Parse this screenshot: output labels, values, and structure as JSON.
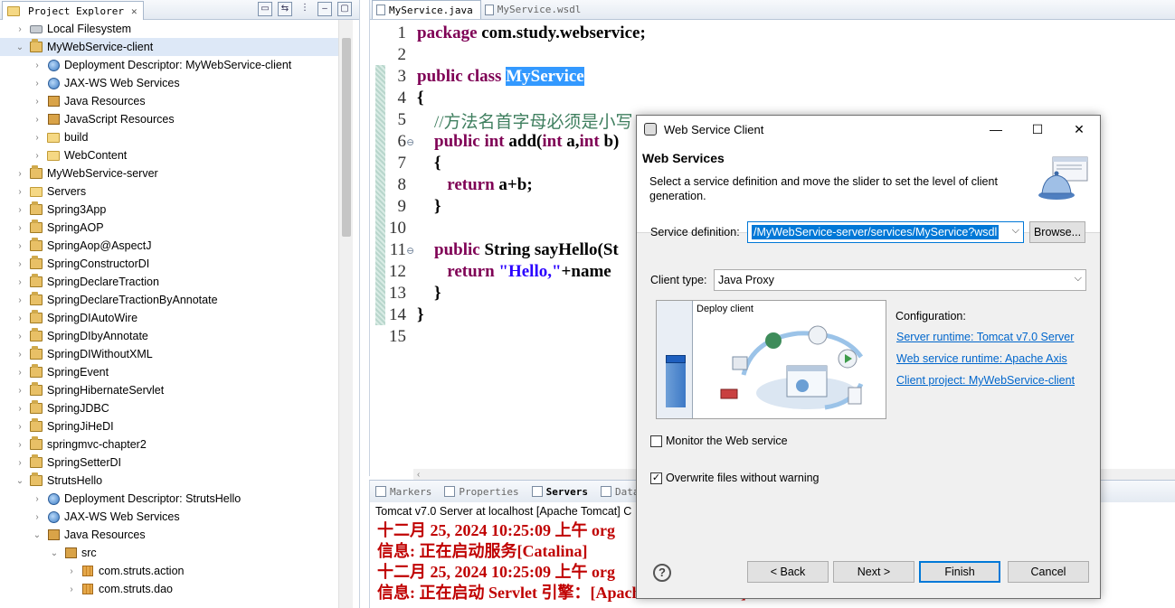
{
  "explorer": {
    "tab_label": "Project Explorer",
    "tree": [
      {
        "label": "Local Filesystem",
        "indent": 0,
        "chevron": "›",
        "icon": "drive"
      },
      {
        "label": "MyWebService-client",
        "indent": 0,
        "chevron": "⌄",
        "icon": "proj",
        "selected": true
      },
      {
        "label": "Deployment Descriptor: MyWebService-client",
        "indent": 1,
        "chevron": "›",
        "icon": "globe"
      },
      {
        "label": "JAX-WS Web Services",
        "indent": 1,
        "chevron": "›",
        "icon": "globe"
      },
      {
        "label": "Java Resources",
        "indent": 1,
        "chevron": "›",
        "icon": "jarpkg"
      },
      {
        "label": "JavaScript Resources",
        "indent": 1,
        "chevron": "›",
        "icon": "jarpkg"
      },
      {
        "label": "build",
        "indent": 1,
        "chevron": "›",
        "icon": "folder"
      },
      {
        "label": "WebContent",
        "indent": 1,
        "chevron": "›",
        "icon": "folder"
      },
      {
        "label": "MyWebService-server",
        "indent": 0,
        "chevron": "›",
        "icon": "proj"
      },
      {
        "label": "Servers",
        "indent": 0,
        "chevron": "›",
        "icon": "folder"
      },
      {
        "label": "Spring3App",
        "indent": 0,
        "chevron": "›",
        "icon": "proj"
      },
      {
        "label": "SpringAOP",
        "indent": 0,
        "chevron": "›",
        "icon": "proj"
      },
      {
        "label": "SpringAop@AspectJ",
        "indent": 0,
        "chevron": "›",
        "icon": "proj"
      },
      {
        "label": "SpringConstructorDI",
        "indent": 0,
        "chevron": "›",
        "icon": "proj"
      },
      {
        "label": "SpringDeclareTraction",
        "indent": 0,
        "chevron": "›",
        "icon": "proj"
      },
      {
        "label": "SpringDeclareTractionByAnnotate",
        "indent": 0,
        "chevron": "›",
        "icon": "proj"
      },
      {
        "label": "SpringDIAutoWire",
        "indent": 0,
        "chevron": "›",
        "icon": "proj"
      },
      {
        "label": "SpringDIbyAnnotate",
        "indent": 0,
        "chevron": "›",
        "icon": "proj"
      },
      {
        "label": "SpringDIWithoutXML",
        "indent": 0,
        "chevron": "›",
        "icon": "proj"
      },
      {
        "label": "SpringEvent",
        "indent": 0,
        "chevron": "›",
        "icon": "proj"
      },
      {
        "label": "SpringHibernateServlet",
        "indent": 0,
        "chevron": "›",
        "icon": "proj"
      },
      {
        "label": "SpringJDBC",
        "indent": 0,
        "chevron": "›",
        "icon": "proj"
      },
      {
        "label": "SpringJiHeDI",
        "indent": 0,
        "chevron": "›",
        "icon": "proj"
      },
      {
        "label": "springmvc-chapter2",
        "indent": 0,
        "chevron": "›",
        "icon": "proj"
      },
      {
        "label": "SpringSetterDI",
        "indent": 0,
        "chevron": "›",
        "icon": "proj"
      },
      {
        "label": "StrutsHello",
        "indent": 0,
        "chevron": "⌄",
        "icon": "proj"
      },
      {
        "label": "Deployment Descriptor: StrutsHello",
        "indent": 1,
        "chevron": "›",
        "icon": "globe"
      },
      {
        "label": "JAX-WS Web Services",
        "indent": 1,
        "chevron": "›",
        "icon": "globe"
      },
      {
        "label": "Java Resources",
        "indent": 1,
        "chevron": "⌄",
        "icon": "jarpkg"
      },
      {
        "label": "src",
        "indent": 2,
        "chevron": "⌄",
        "icon": "jarpkg"
      },
      {
        "label": "com.struts.action",
        "indent": 3,
        "chevron": "›",
        "icon": "pkg"
      },
      {
        "label": "com.struts.dao",
        "indent": 3,
        "chevron": "›",
        "icon": "pkg"
      }
    ]
  },
  "editor": {
    "tabs": [
      {
        "label": "MyService.java",
        "active": true
      },
      {
        "label": "MyService.wsdl",
        "active": false
      }
    ],
    "lines": [
      {
        "n": "1",
        "fold": "",
        "parts": [
          {
            "t": "package ",
            "c": "kw"
          },
          {
            "t": "com.study.webservice;",
            "c": ""
          }
        ]
      },
      {
        "n": "2",
        "fold": "",
        "parts": []
      },
      {
        "n": "3",
        "fold": "",
        "parts": [
          {
            "t": "public class ",
            "c": "kw"
          },
          {
            "t": "MyService",
            "c": "sel"
          }
        ]
      },
      {
        "n": "4",
        "fold": "",
        "parts": [
          {
            "t": "{",
            "c": ""
          }
        ]
      },
      {
        "n": "5",
        "fold": "",
        "parts": [
          {
            "t": "    //方法名首字母必须是小写",
            "c": "cmt"
          }
        ]
      },
      {
        "n": "6",
        "fold": "⊖",
        "parts": [
          {
            "t": "    ",
            "c": ""
          },
          {
            "t": "public int ",
            "c": "kw"
          },
          {
            "t": "add(",
            "c": ""
          },
          {
            "t": "int ",
            "c": "kw"
          },
          {
            "t": "a,",
            "c": ""
          },
          {
            "t": "int ",
            "c": "kw"
          },
          {
            "t": "b)",
            "c": ""
          }
        ]
      },
      {
        "n": "7",
        "fold": "",
        "parts": [
          {
            "t": "    {",
            "c": ""
          }
        ]
      },
      {
        "n": "8",
        "fold": "",
        "parts": [
          {
            "t": "       ",
            "c": ""
          },
          {
            "t": "return ",
            "c": "kw"
          },
          {
            "t": "a+b;",
            "c": ""
          }
        ]
      },
      {
        "n": "9",
        "fold": "",
        "parts": [
          {
            "t": "    }",
            "c": ""
          }
        ]
      },
      {
        "n": "10",
        "fold": "",
        "parts": []
      },
      {
        "n": "11",
        "fold": "⊖",
        "parts": [
          {
            "t": "    ",
            "c": ""
          },
          {
            "t": "public ",
            "c": "kw"
          },
          {
            "t": "String sayHello(St",
            "c": ""
          }
        ]
      },
      {
        "n": "12",
        "fold": "",
        "parts": [
          {
            "t": "       ",
            "c": ""
          },
          {
            "t": "return ",
            "c": "kw"
          },
          {
            "t": "\"Hello,\"",
            "c": "str"
          },
          {
            "t": "+name",
            "c": ""
          }
        ]
      },
      {
        "n": "13",
        "fold": "",
        "parts": [
          {
            "t": "    }",
            "c": ""
          }
        ]
      },
      {
        "n": "14",
        "fold": "",
        "parts": [
          {
            "t": "}",
            "c": ""
          }
        ]
      },
      {
        "n": "15",
        "fold": "",
        "parts": []
      }
    ]
  },
  "servers": {
    "tabs": [
      {
        "label": "Markers",
        "active": false
      },
      {
        "label": "Properties",
        "active": false
      },
      {
        "label": "Servers",
        "active": true
      },
      {
        "label": "Data S",
        "active": false
      }
    ],
    "status": "Tomcat v7.0 Server at localhost [Apache Tomcat] C",
    "console": [
      "十二月 25, 2024 10:25:09 上午 org",
      "信息: 正在启动服务[Catalina]",
      "十二月 25, 2024 10:25:09 上午 org",
      "信息: 正在启动 Servlet 引擎：[Apache Tomcat/7.0.0]"
    ]
  },
  "dialog": {
    "title": "Web Service Client",
    "heading": "Web Services",
    "description": "Select a service definition and move the slider to set the level of client generation.",
    "service_definition_label": "Service definition:",
    "service_definition_value": "/MyWebService-server/services/MyService?wsdl",
    "browse_label": "Browse...",
    "client_type_label": "Client type:",
    "client_type_value": "Java Proxy",
    "slider_caption": "Deploy client",
    "slider_level": 0.5,
    "configuration_label": "Configuration:",
    "links": [
      "Server runtime: Tomcat v7.0 Server",
      "Web service runtime: Apache Axis",
      "Client project: MyWebService-client"
    ],
    "monitor_label": "Monitor the Web service",
    "monitor_checked": false,
    "overwrite_label": "Overwrite files without warning",
    "overwrite_checked": true,
    "buttons": {
      "back": "< Back",
      "next": "Next >",
      "finish": "Finish",
      "cancel": "Cancel"
    }
  }
}
